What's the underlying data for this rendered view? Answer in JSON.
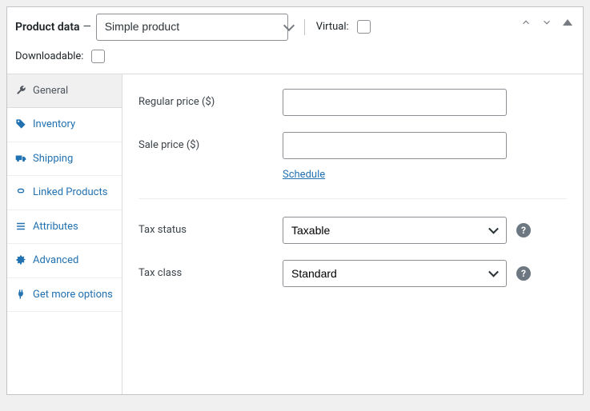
{
  "header": {
    "title": "Product data",
    "dash": " — ",
    "product_type": "Simple product",
    "virtual_label": "Virtual:",
    "downloadable_label": "Downloadable:"
  },
  "tabs": [
    {
      "label": "General"
    },
    {
      "label": "Inventory"
    },
    {
      "label": "Shipping"
    },
    {
      "label": "Linked Products"
    },
    {
      "label": "Attributes"
    },
    {
      "label": "Advanced"
    },
    {
      "label": "Get more options"
    }
  ],
  "general": {
    "regular_price_label": "Regular price ($)",
    "regular_price_value": "",
    "sale_price_label": "Sale price ($)",
    "sale_price_value": "",
    "schedule_link": "Schedule",
    "tax_status_label": "Tax status",
    "tax_status_value": "Taxable",
    "tax_class_label": "Tax class",
    "tax_class_value": "Standard",
    "help_glyph": "?"
  }
}
